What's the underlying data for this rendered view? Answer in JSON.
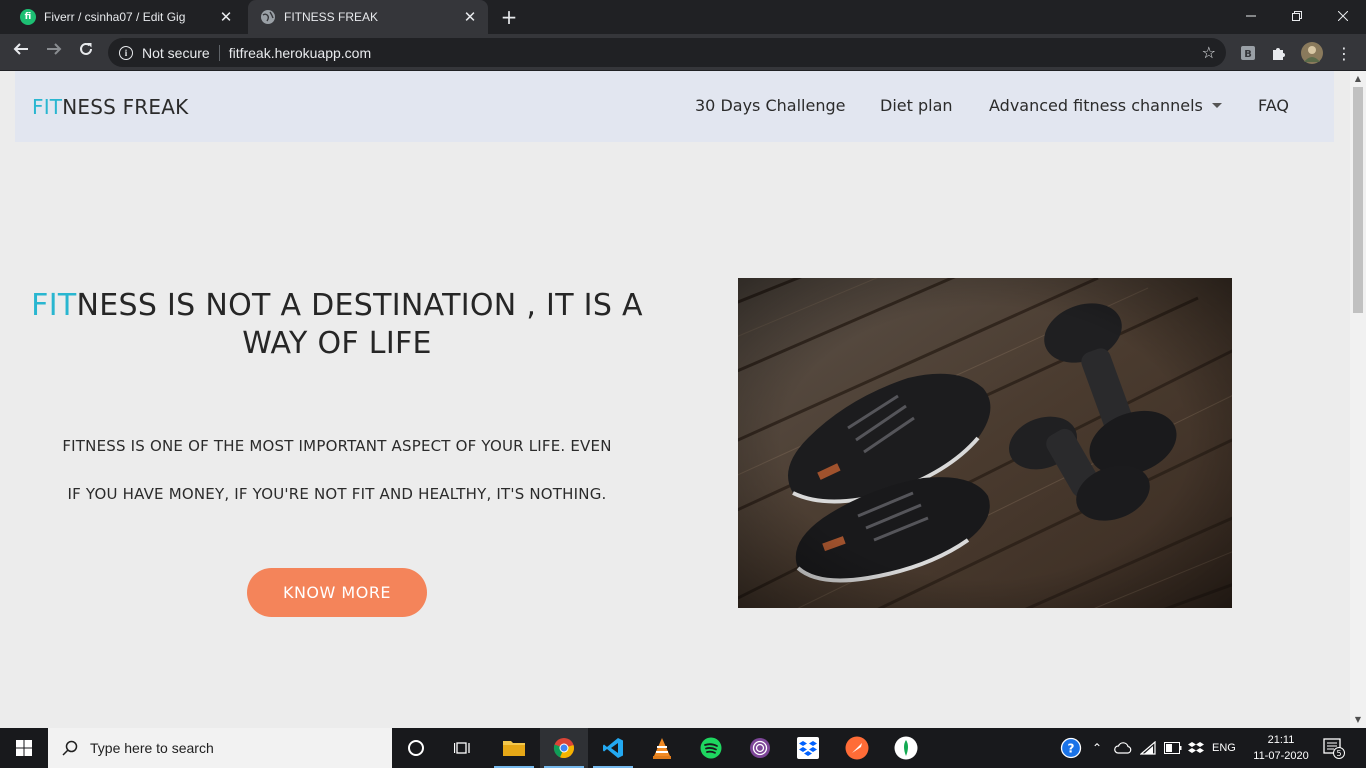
{
  "browser": {
    "tabs": [
      {
        "title": "Fiverr / csinha07 / Edit Gig",
        "favicon": "fiverr-icon",
        "favicon_text": "fi",
        "favicon_color": "#1dbf73",
        "active": false
      },
      {
        "title": "FITNESS FREAK",
        "favicon": "globe-icon",
        "active": true
      }
    ],
    "address": {
      "security_label": "Not secure",
      "url": "fitfreak.herokuapp.com"
    }
  },
  "site": {
    "brand": {
      "accent": "FIT",
      "rest": "NESS FREAK"
    },
    "nav": [
      {
        "label": "30 Days Challenge"
      },
      {
        "label": "Diet plan"
      },
      {
        "label": "Advanced fitness channels",
        "dropdown": true
      },
      {
        "label": "FAQ"
      }
    ],
    "hero": {
      "title_accent": "FIT",
      "title_rest": "NESS IS NOT A DESTINATION , IT IS A WAY OF LIFE",
      "line1": "FITNESS IS ONE OF THE MOST IMPORTANT ASPECT OF YOUR LIFE. EVEN",
      "line2": "IF YOU HAVE MONEY, IF YOU'RE NOT FIT AND HEALTHY, IT'S NOTHING.",
      "cta": "KNOW MORE"
    },
    "colors": {
      "accent": "#29b6d0",
      "cta": "#f4845a",
      "navbar": "#e2e6f0",
      "background": "#ececec"
    }
  },
  "taskbar": {
    "search_placeholder": "Type here to search",
    "apps": [
      "task-view-icon",
      "file-explorer-icon",
      "chrome-icon",
      "vscode-icon",
      "vlc-icon",
      "spotify-icon",
      "tor-icon",
      "dropbox-icon",
      "postman-icon",
      "mongodb-compass-icon"
    ],
    "language": "ENG",
    "time": "21:11",
    "date": "11-07-2020",
    "notification_count": "5"
  }
}
